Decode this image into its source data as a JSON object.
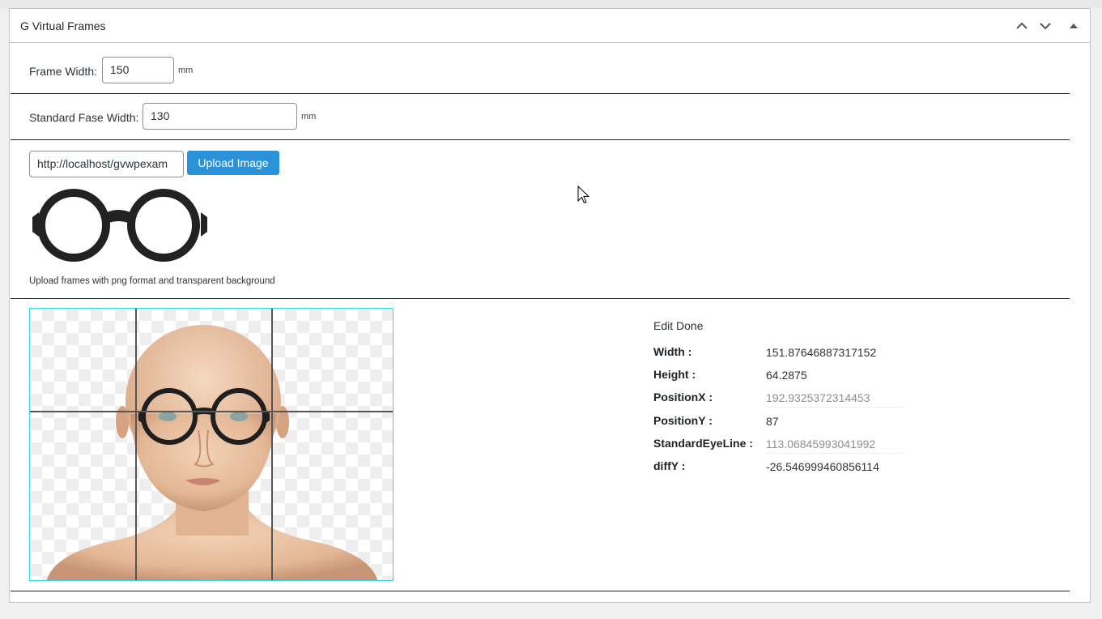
{
  "panel": {
    "title": "G Virtual Frames"
  },
  "frame_width": {
    "label": "Frame Width:",
    "value": "150",
    "unit": "mm"
  },
  "face_width": {
    "label": "Standard Fase Width:",
    "value": "130",
    "unit": "mm"
  },
  "upload": {
    "url_value": "http://localhost/gvwpexam",
    "button_label": "Upload Image",
    "hint": "Upload frames with png format and transparent background"
  },
  "editor": {
    "status": "Edit Done",
    "stats": [
      {
        "label": "Width :",
        "value": "151.87646887317152"
      },
      {
        "label": "Height :",
        "value": "64.2875"
      },
      {
        "label": "PositionX :",
        "value": "192.9325372314453"
      },
      {
        "label": "PositionY :",
        "value": "87"
      },
      {
        "label": "StandardEyeLine :",
        "value": "113.06845993041992"
      },
      {
        "label": "diffY :",
        "value": "-26.546999460856114"
      }
    ]
  },
  "colors": {
    "accent": "#2b92d9",
    "canvas_border": "#33d6e4"
  }
}
